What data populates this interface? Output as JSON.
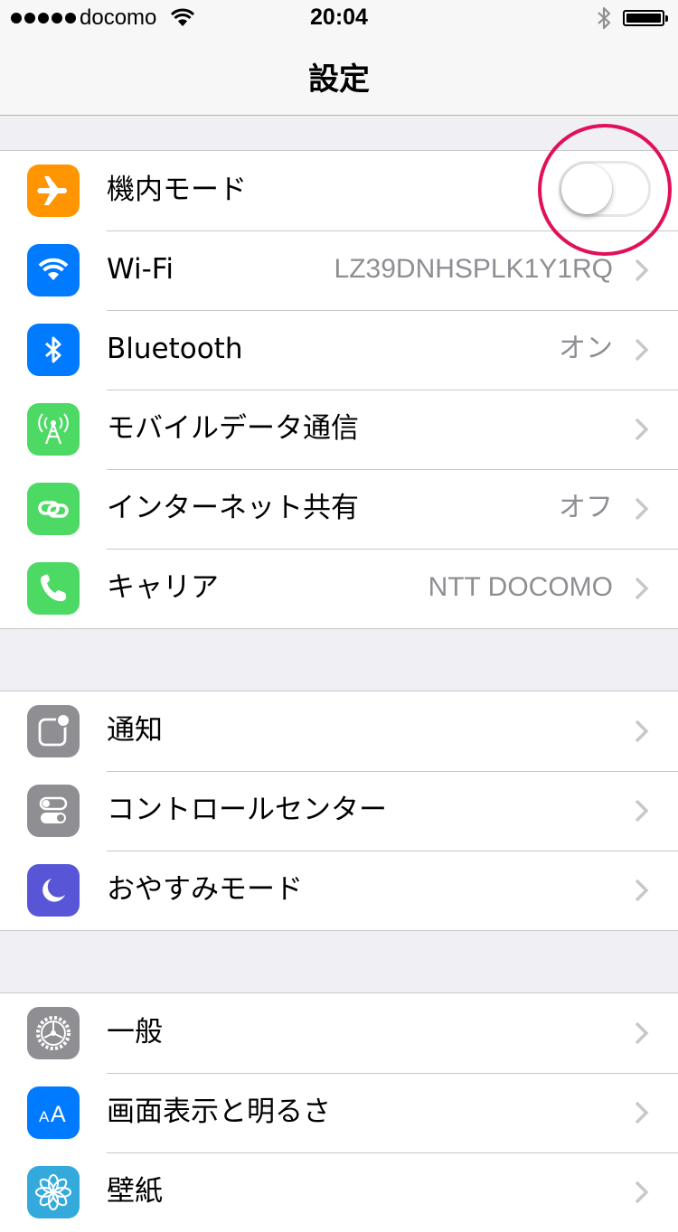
{
  "status_bar": {
    "carrier": "docomo",
    "time": "20:04",
    "icons": [
      "signal-dots",
      "wifi-icon",
      "bluetooth-icon",
      "battery-icon"
    ]
  },
  "nav": {
    "title": "設定"
  },
  "groups": [
    {
      "rows": [
        {
          "icon": "airplane-icon",
          "color": "#ff9500",
          "label": "機内モード",
          "toggle": "off"
        },
        {
          "icon": "wifi-icon",
          "color": "#007aff",
          "label": "Wi-Fi",
          "value": "LZ39DNHSPLK1Y1RQ"
        },
        {
          "icon": "bluetooth-icon",
          "color": "#007aff",
          "label": "Bluetooth",
          "value": "オン"
        },
        {
          "icon": "cellular-antenna-icon",
          "color": "#4cd964",
          "label": "モバイルデータ通信"
        },
        {
          "icon": "personal-hotspot-icon",
          "color": "#4cd964",
          "label": "インターネット共有",
          "value": "オフ"
        },
        {
          "icon": "phone-icon",
          "color": "#4cd964",
          "label": "キャリア",
          "value": "NTT DOCOMO"
        }
      ]
    },
    {
      "rows": [
        {
          "icon": "notifications-icon",
          "color": "#8e8e93",
          "label": "通知"
        },
        {
          "icon": "control-center-icon",
          "color": "#8e8e93",
          "label": "コントロールセンター"
        },
        {
          "icon": "moon-icon",
          "color": "#5856d6",
          "label": "おやすみモード"
        }
      ]
    },
    {
      "rows": [
        {
          "icon": "gear-icon",
          "color": "#8e8e93",
          "label": "一般"
        },
        {
          "icon": "text-size-icon",
          "color": "#007aff",
          "label": "画面表示と明るさ"
        },
        {
          "icon": "flower-icon",
          "color": "#34aadc",
          "label": "壁紙"
        }
      ]
    }
  ],
  "highlight_color": "#e0105a"
}
